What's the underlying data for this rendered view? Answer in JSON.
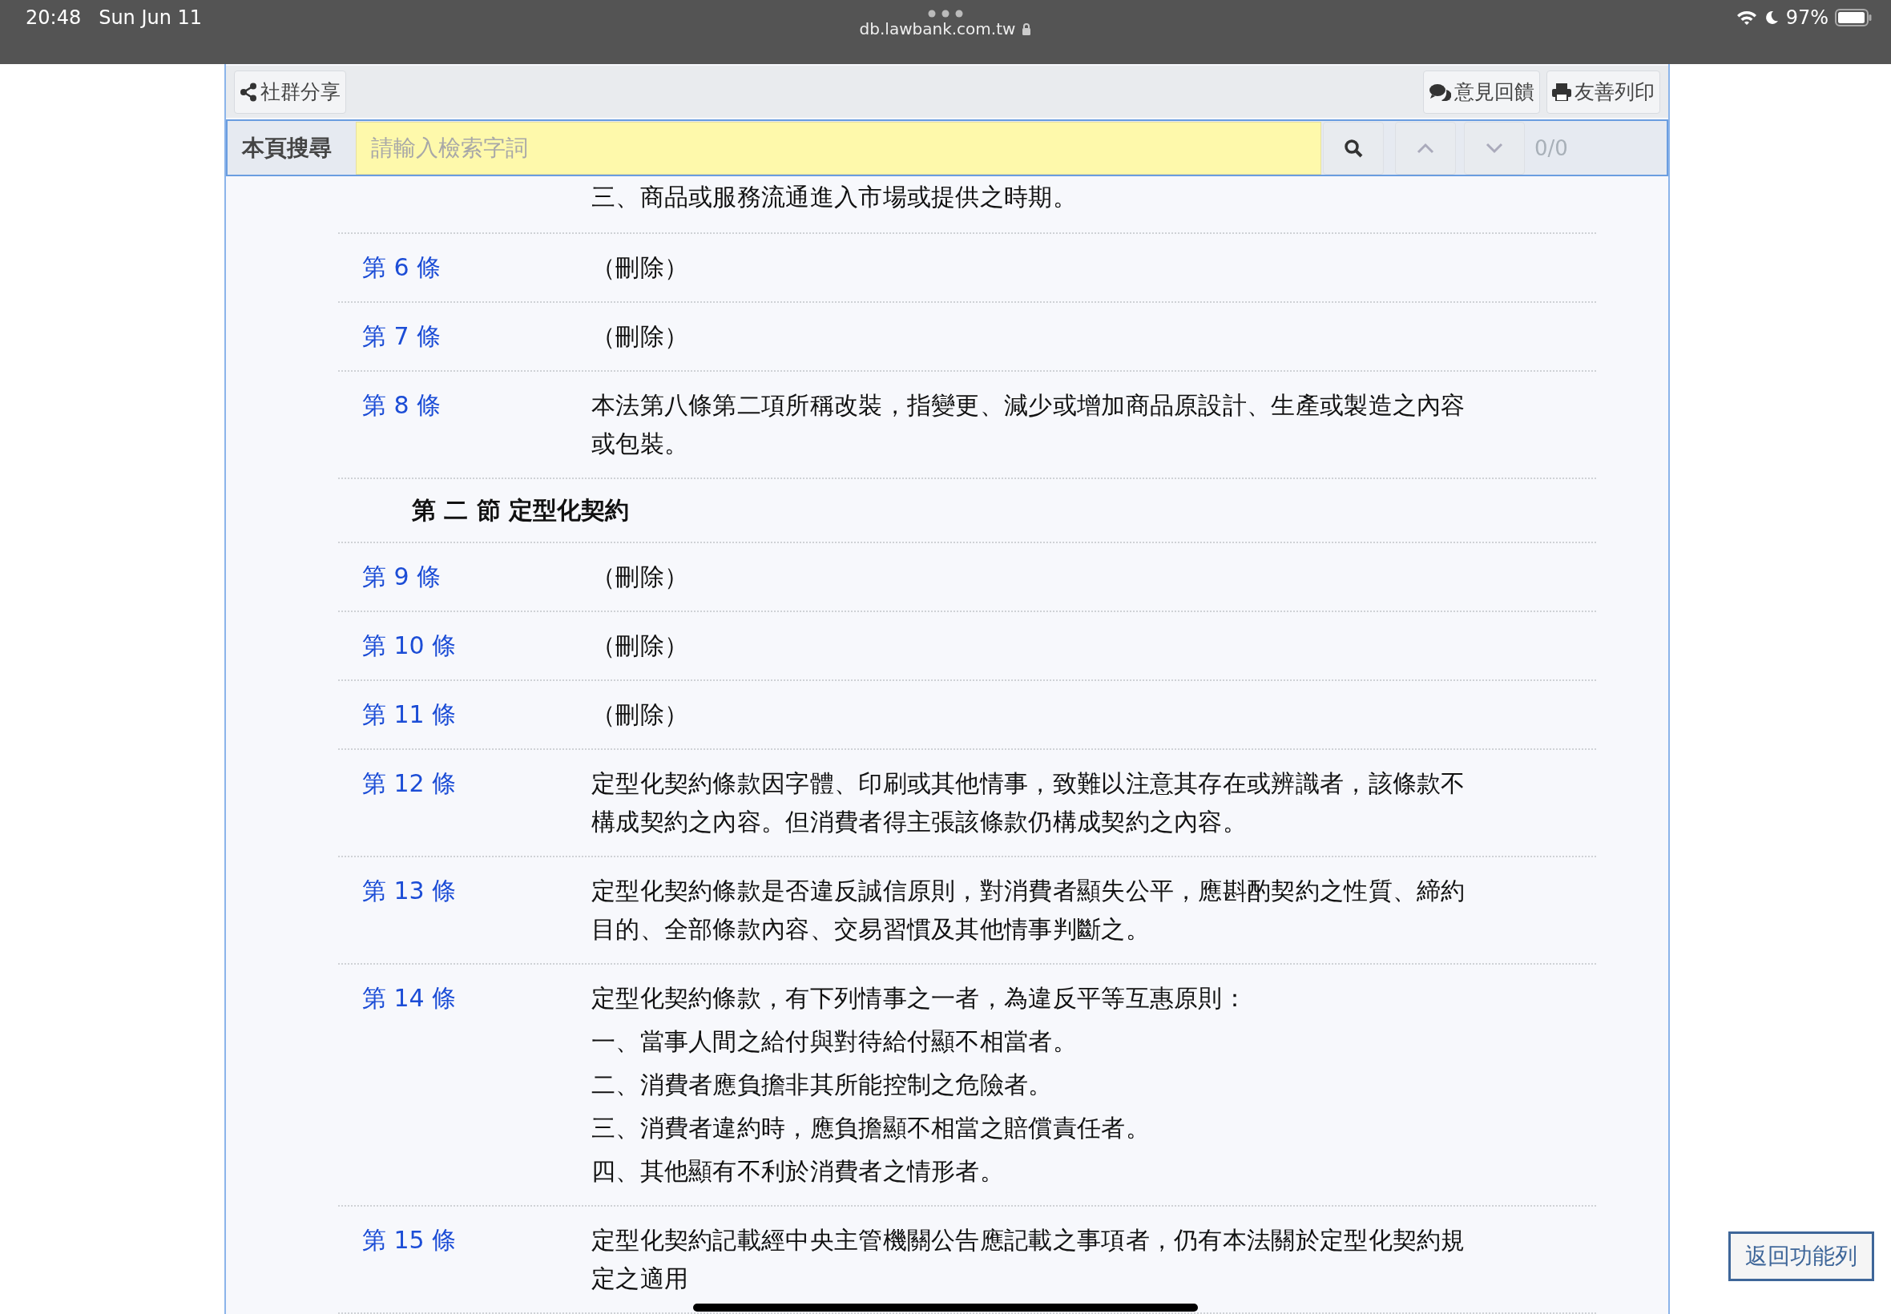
{
  "status_bar": {
    "time": "20:48",
    "date": "Sun Jun 11",
    "url": "db.lawbank.com.tw",
    "battery": "97%"
  },
  "toolbar": {
    "share": "社群分享",
    "feedback": "意見回饋",
    "print": "友善列印"
  },
  "search": {
    "label": "本頁搜尋",
    "placeholder": "請輸入檢索字詞",
    "count": "0/0"
  },
  "rows": [
    {
      "kind": "continuation",
      "paragraphs": [
        "三、商品或服務流通進入市場或提供之時期。"
      ]
    },
    {
      "kind": "article",
      "label": "第 6 條",
      "paragraphs": [
        "（刪除）"
      ]
    },
    {
      "kind": "article",
      "label": "第 7 條",
      "paragraphs": [
        "（刪除）"
      ]
    },
    {
      "kind": "article",
      "label": "第 8 條",
      "paragraphs": [
        "本法第八條第二項所稱改裝，指變更、減少或增加商品原設計、生產或製造之內容或包裝。"
      ]
    },
    {
      "kind": "section",
      "title": "第 二 節 定型化契約"
    },
    {
      "kind": "article",
      "label": "第 9 條",
      "paragraphs": [
        "（刪除）"
      ]
    },
    {
      "kind": "article",
      "label": "第 10 條",
      "paragraphs": [
        "（刪除）"
      ]
    },
    {
      "kind": "article",
      "label": "第 11 條",
      "paragraphs": [
        "（刪除）"
      ]
    },
    {
      "kind": "article",
      "label": "第 12 條",
      "paragraphs": [
        "定型化契約條款因字體、印刷或其他情事，致難以注意其存在或辨識者，該條款不構成契約之內容。但消費者得主張該條款仍構成契約之內容。"
      ]
    },
    {
      "kind": "article",
      "label": "第 13 條",
      "paragraphs": [
        "定型化契約條款是否違反誠信原則，對消費者顯失公平，應斟酌契約之性質、締約目的、全部條款內容、交易習慣及其他情事判斷之。"
      ]
    },
    {
      "kind": "article",
      "label": "第 14 條",
      "paragraphs": [
        "定型化契約條款，有下列情事之一者，為違反平等互惠原則：",
        "一、當事人間之給付與對待給付顯不相當者。",
        "二、消費者應負擔非其所能控制之危險者。",
        "三、消費者違約時，應負擔顯不相當之賠償責任者。",
        "四、其他顯有不利於消費者之情形者。"
      ]
    },
    {
      "kind": "article",
      "label": "第 15 條",
      "paragraphs": [
        "定型化契約記載經中央主管機關公告應記載之事項者，仍有本法關於定型化契約規定之適用"
      ]
    }
  ],
  "back_button": "返回功能列"
}
